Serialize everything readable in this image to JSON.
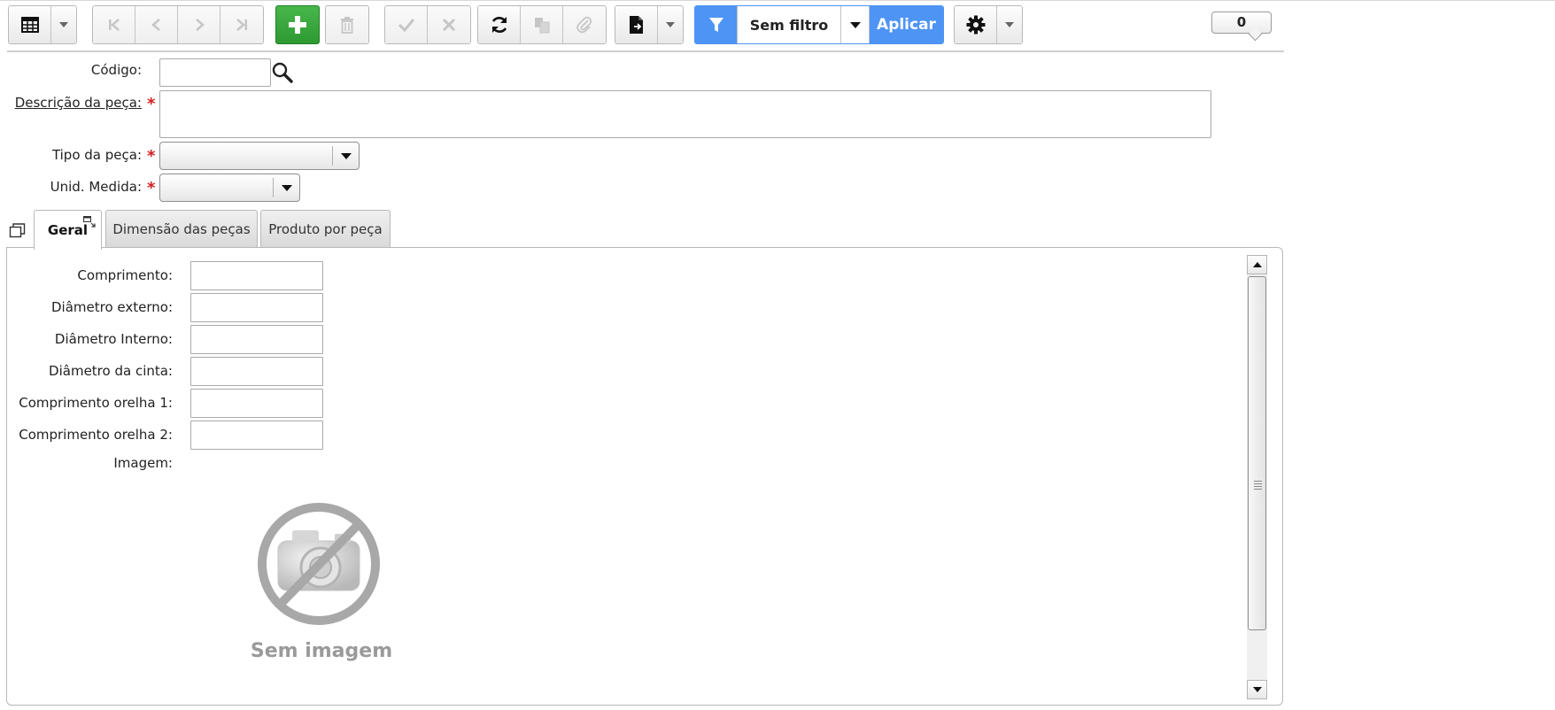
{
  "toolbar": {
    "filter_label": "Sem filtro",
    "apply_label": "Aplicar",
    "counter": "0"
  },
  "form": {
    "codigo": {
      "label": "Código:",
      "value": ""
    },
    "descricao": {
      "label": "Descrição da peça:",
      "value": "",
      "required_mark": "*"
    },
    "tipo": {
      "label": "Tipo da peça:",
      "value": "",
      "required_mark": "*"
    },
    "unidade": {
      "label": "Unid. Medida:",
      "value": "",
      "required_mark": "*"
    }
  },
  "tabs": [
    {
      "label": "Geral",
      "active": true
    },
    {
      "label": "Dimensão das peças",
      "active": false
    },
    {
      "label": "Produto por peça",
      "active": false
    }
  ],
  "geral": {
    "fields": [
      {
        "label": "Comprimento:",
        "value": ""
      },
      {
        "label": "Diâmetro externo:",
        "value": ""
      },
      {
        "label": "Diâmetro Interno:",
        "value": ""
      },
      {
        "label": "Diâmetro da cinta:",
        "value": ""
      },
      {
        "label": "Comprimento orelha 1:",
        "value": ""
      },
      {
        "label": "Comprimento orelha 2:",
        "value": ""
      }
    ],
    "image_label": "Imagem:",
    "no_image_caption": "Sem imagem"
  },
  "colors": {
    "add_green": "#2d9a31",
    "filter_blue": "#4d94f5",
    "required_red": "#d32020"
  }
}
